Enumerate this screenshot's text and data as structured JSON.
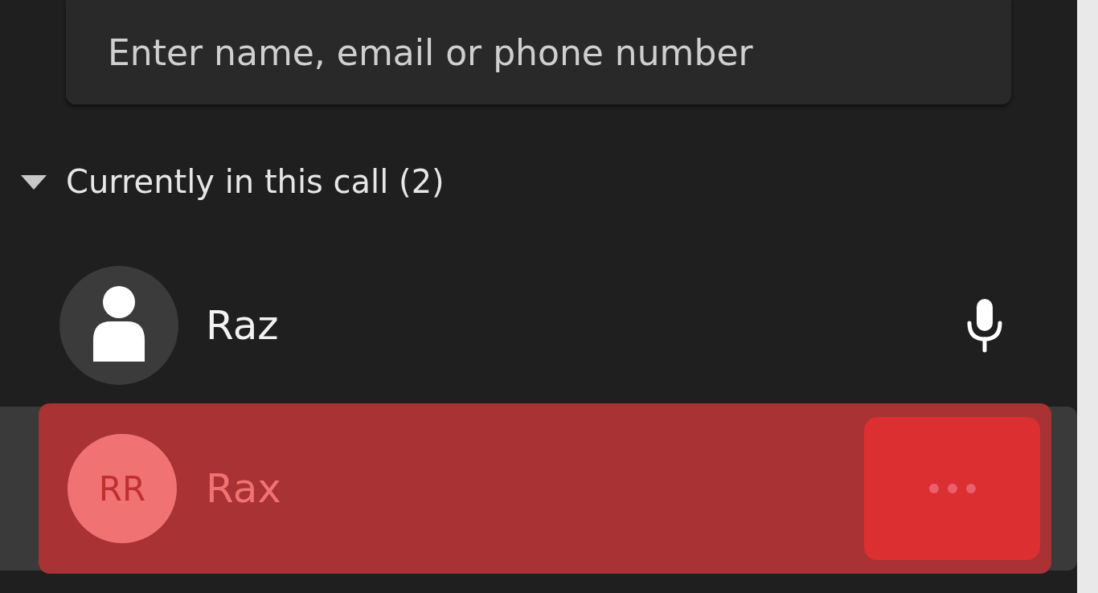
{
  "search": {
    "placeholder": "Enter name, email or phone number"
  },
  "section": {
    "title": "Currently in this call (2)",
    "expanded": true
  },
  "participants": [
    {
      "name": "Raz",
      "kind": "silhouette",
      "selected": false
    },
    {
      "name": "Rax",
      "kind": "initials",
      "initials": "RR",
      "selected": true
    }
  ]
}
